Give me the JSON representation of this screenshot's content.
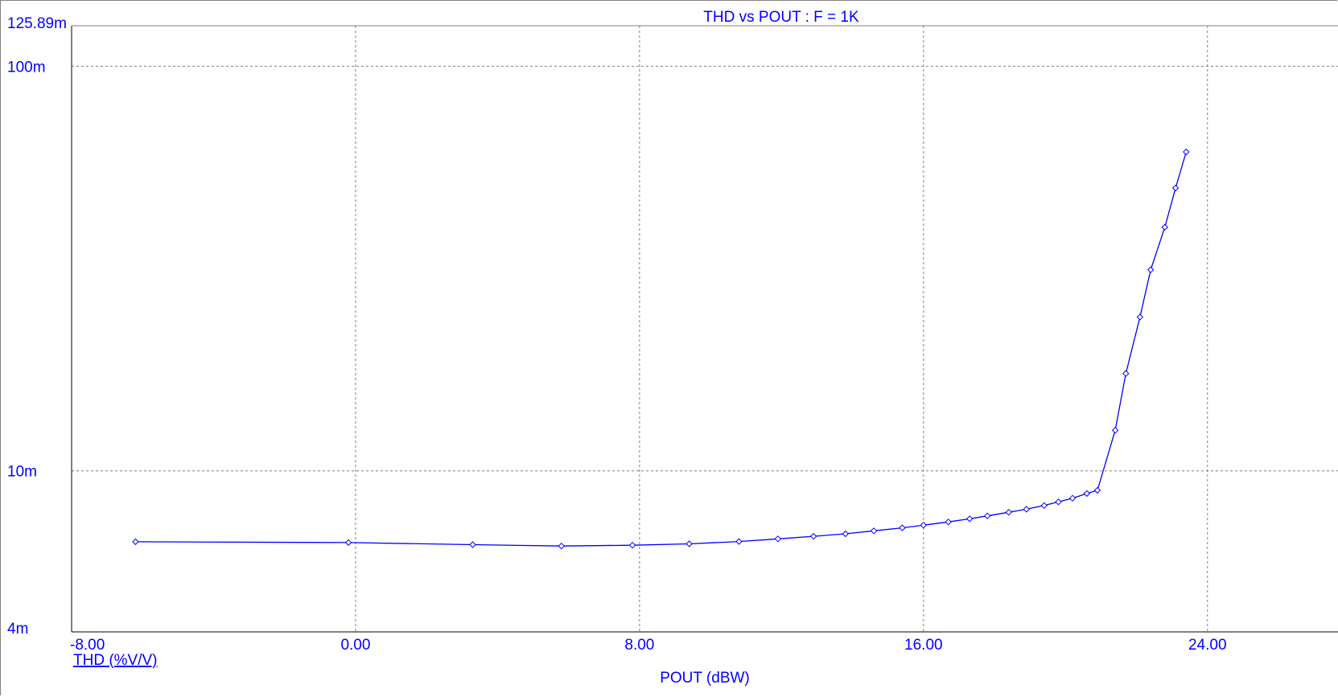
{
  "chart_data": {
    "type": "line",
    "title": "THD vs POUT : F = 1K",
    "xlabel": "POUT (dBW)",
    "ylabel": "THD (%V/V)",
    "x_scale": "linear",
    "y_scale": "log",
    "xlim": [
      -8,
      27.7
    ],
    "ylim": [
      0.004,
      0.12589
    ],
    "grid": true,
    "x_ticks": [
      {
        "value": -8,
        "label": "-8.00"
      },
      {
        "value": 0,
        "label": "0.00"
      },
      {
        "value": 8,
        "label": "8.00"
      },
      {
        "value": 16,
        "label": "16.00"
      },
      {
        "value": 24,
        "label": "24.00"
      }
    ],
    "y_ticks": [
      {
        "value": 0.12589,
        "label": "125.89m"
      },
      {
        "value": 0.1,
        "label": "100m"
      },
      {
        "value": 0.01,
        "label": "10m"
      },
      {
        "value": 0.004,
        "label": "4m"
      }
    ],
    "colors": {
      "series": "#0000ff",
      "text": "#0000ff",
      "axis": "#000000",
      "grid": "#808080",
      "frame": "#808080"
    },
    "series": [
      {
        "name": "THD (%V/V)",
        "markers": "diamond",
        "x": [
          -6.2,
          -0.2,
          3.3,
          5.8,
          7.8,
          9.4,
          10.8,
          11.9,
          12.9,
          13.8,
          14.6,
          15.4,
          16.0,
          16.7,
          17.3,
          17.8,
          18.4,
          18.9,
          19.4,
          19.8,
          20.2,
          20.6,
          20.9,
          21.4,
          21.7,
          22.1,
          22.4,
          22.8,
          23.1,
          23.4
        ],
        "y": [
          0.00668,
          0.00665,
          0.00657,
          0.00652,
          0.00655,
          0.0066,
          0.00669,
          0.00679,
          0.00689,
          0.00699,
          0.00711,
          0.00723,
          0.00734,
          0.00748,
          0.00761,
          0.00774,
          0.0079,
          0.00804,
          0.00821,
          0.00838,
          0.00856,
          0.00879,
          0.00895,
          0.0126,
          0.0174,
          0.024,
          0.0314,
          0.04,
          0.05,
          0.0614
        ]
      }
    ]
  }
}
